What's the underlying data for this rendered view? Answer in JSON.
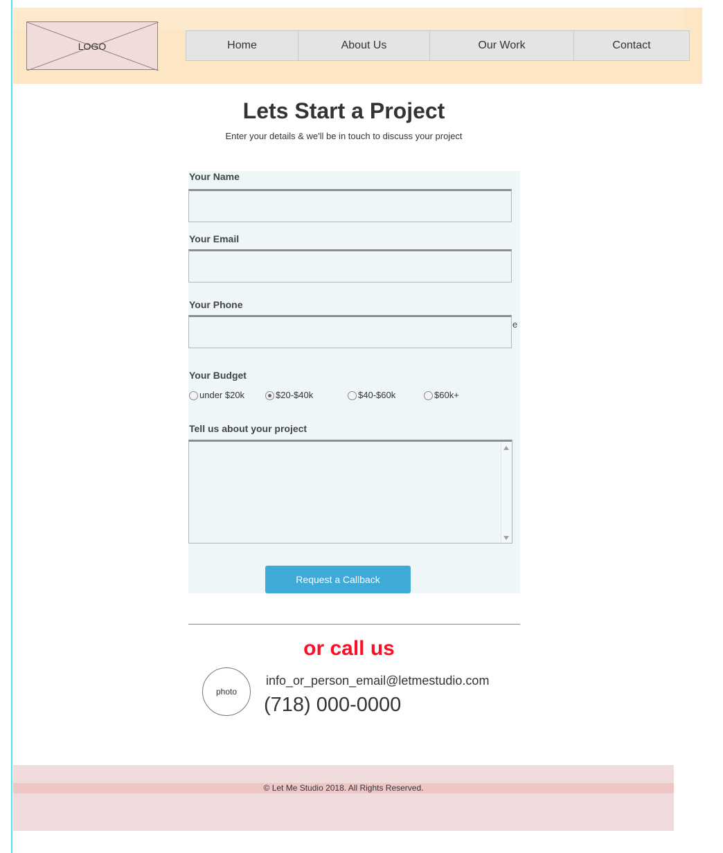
{
  "header": {
    "logo_text": "LOGO",
    "nav": [
      "Home",
      "About Us",
      "Our Work",
      "Contact"
    ]
  },
  "hero": {
    "title": "Lets Start a Project",
    "subtitle": "Enter your details & we'll be in touch to discuss your project"
  },
  "form": {
    "name_label": "Your Name",
    "name_value": "",
    "email_label": "Your Email",
    "email_value": "",
    "phone_label": "Your Phone",
    "phone_value": "",
    "stray_char": "e",
    "budget_label": "Your Budget",
    "budget_options": [
      "under $20k",
      "$20-$40k",
      "$40-$60k",
      "$60k+"
    ],
    "budget_selected": "$20-$40k",
    "project_label": "Tell us about your project",
    "project_value": "",
    "submit_label": "Request a Callback"
  },
  "contact": {
    "heading": "or call us",
    "photo_label": "photo",
    "email": "info_or_person_email@letmestudio.com",
    "phone": "(718) 000-0000",
    "heading_color": "#ff0d24"
  },
  "footer": {
    "copyright": "© Let Me Studio 2018. All Rights Reserved."
  },
  "colors": {
    "header_bg": "#fde6c4",
    "form_bg": "#eef6f7",
    "button_bg": "#3fa9d8",
    "footer_bg": "#f0dcdc"
  }
}
